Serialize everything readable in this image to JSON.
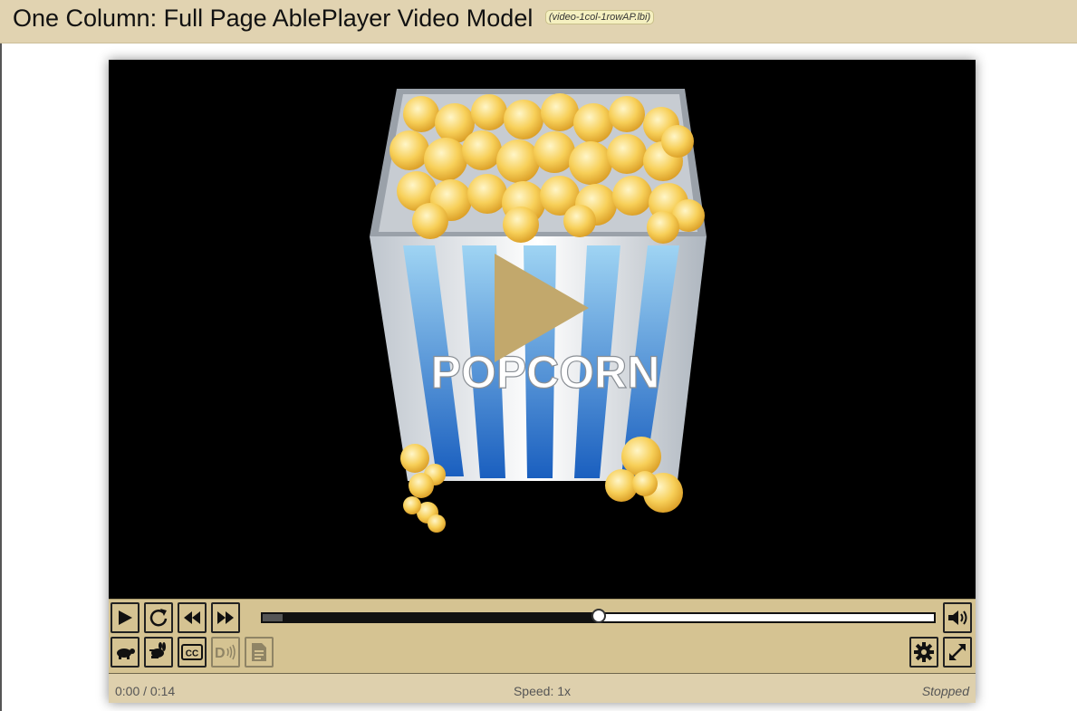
{
  "header": {
    "title": "One Column: Full Page AblePlayer Video Model",
    "tag": "(video-1col-1rowAP.lbi)"
  },
  "video": {
    "poster_text": "POPCORN",
    "big_play_icon": "play-icon"
  },
  "controls": {
    "row1": [
      "play-icon",
      "restart-icon",
      "rewind-icon",
      "forward-icon"
    ],
    "row2": [
      "slower-icon",
      "faster-icon",
      "captions-icon",
      "audio-description-icon",
      "transcript-icon"
    ],
    "right_row1": [
      "volume-icon"
    ],
    "right_row2": [
      "preferences-icon",
      "fullscreen-icon"
    ],
    "captions_label": "CC",
    "description_label": "D",
    "seek_played_fraction": 0.5
  },
  "status": {
    "time": "0:00 / 0:14",
    "speed": "Speed: 1x",
    "state": "Stopped"
  },
  "colors": {
    "header_bg": "#e1d3b1",
    "controls_bg": "#d5c392",
    "status_bg": "#ded0ad",
    "accent": "#c2a86c"
  }
}
